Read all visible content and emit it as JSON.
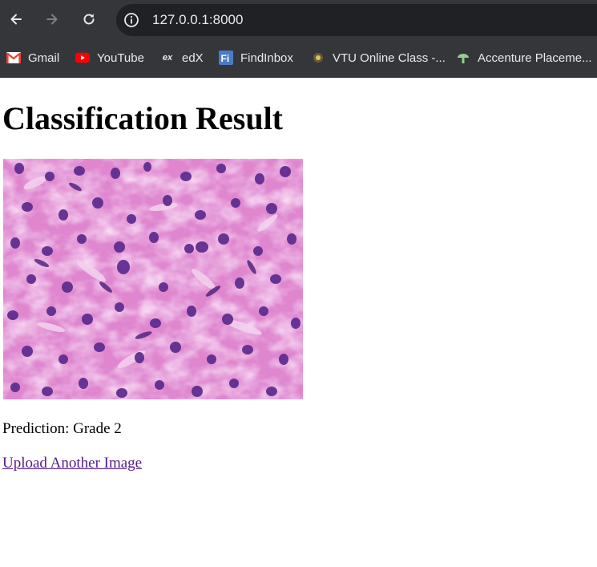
{
  "browser": {
    "url": "127.0.0.1:8000",
    "bookmarks": [
      {
        "label": "Gmail",
        "icon": "gmail-icon"
      },
      {
        "label": "YouTube",
        "icon": "youtube-icon"
      },
      {
        "label": "edX",
        "icon": "edx-icon"
      },
      {
        "label": "FindInbox",
        "icon": "findinbox-icon"
      },
      {
        "label": "VTU Online Class -...",
        "icon": "vtu-icon"
      },
      {
        "label": "Accenture Placeme...",
        "icon": "accenture-icon"
      }
    ]
  },
  "page": {
    "heading": "Classification Result",
    "image_alt": "histopathology-tissue-image",
    "prediction_label": "Prediction: Grade 2",
    "upload_link": "Upload Another Image"
  },
  "colors": {
    "chrome_bg": "#35363a",
    "omnibox_bg": "#202124",
    "link_visited": "#551a8b",
    "tissue_pink": "#e58fd3",
    "nucleus_purple": "#5b2a8e"
  }
}
